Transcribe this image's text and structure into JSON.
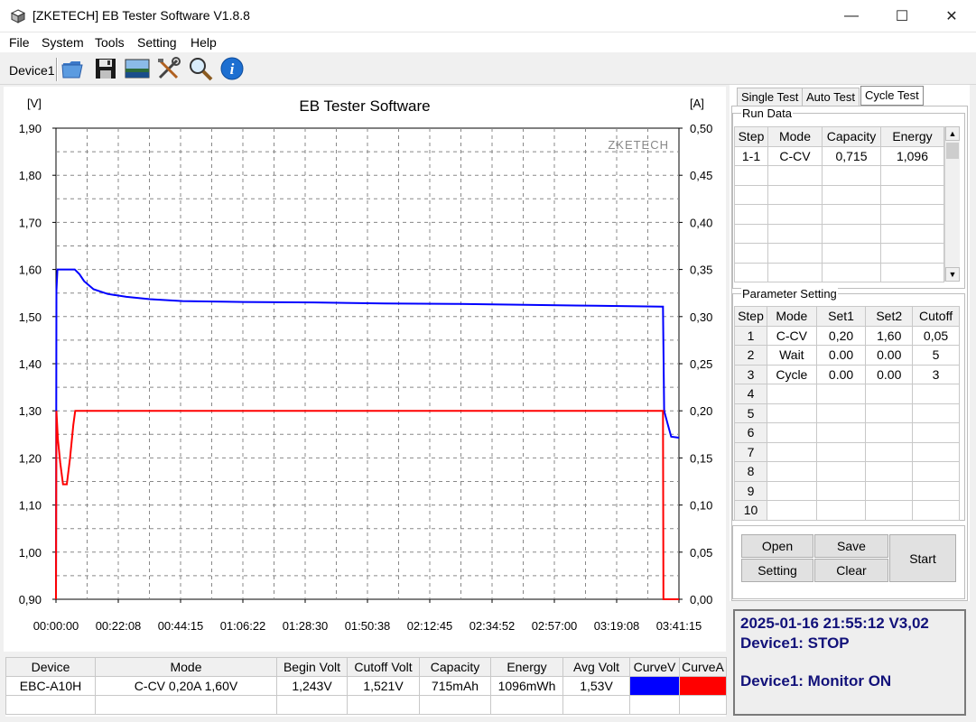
{
  "window": {
    "title": "[ZKETECH] EB Tester Software V1.8.8",
    "minimize": "—",
    "maximize": "☐",
    "close": "✕"
  },
  "menu": [
    "File",
    "System",
    "Tools",
    "Setting",
    "Help"
  ],
  "toolbar": {
    "device": "Device1",
    "icons": [
      "folder-icon",
      "save-icon",
      "image-icon",
      "tools-icon",
      "zoom-icon",
      "info-icon"
    ]
  },
  "chart_data": {
    "type": "line",
    "title": "EB Tester Software",
    "watermark": "ZKETECH",
    "left_axis_unit": "[V]",
    "right_axis_unit": "[A]",
    "ylim_left": [
      0.9,
      1.9
    ],
    "ylim_right": [
      0.0,
      0.5
    ],
    "left_ticks": [
      "1,90",
      "1,80",
      "1,70",
      "1,60",
      "1,50",
      "1,40",
      "1,30",
      "1,20",
      "1,10",
      "1,00",
      "0,90"
    ],
    "right_ticks": [
      "0,50",
      "0,45",
      "0,40",
      "0,35",
      "0,30",
      "0,25",
      "0,20",
      "0,15",
      "0,10",
      "0,05",
      "0,00"
    ],
    "x_ticks": [
      "00:00:00",
      "00:22:08",
      "00:44:15",
      "01:06:22",
      "01:28:30",
      "01:50:38",
      "02:12:45",
      "02:34:52",
      "02:57:00",
      "03:19:08",
      "03:41:15"
    ],
    "xlim_seconds": [
      0,
      13275
    ],
    "grid": true,
    "series": [
      {
        "name": "CurveV",
        "axis": "left",
        "color": "#0000ff",
        "points": [
          [
            0,
            0.9
          ],
          [
            10,
            1.555
          ],
          [
            30,
            1.6
          ],
          [
            400,
            1.6
          ],
          [
            500,
            1.59
          ],
          [
            600,
            1.575
          ],
          [
            800,
            1.558
          ],
          [
            1100,
            1.548
          ],
          [
            1500,
            1.542
          ],
          [
            2000,
            1.537
          ],
          [
            2700,
            1.533
          ],
          [
            4000,
            1.531
          ],
          [
            5500,
            1.53
          ],
          [
            7000,
            1.528
          ],
          [
            8500,
            1.527
          ],
          [
            10000,
            1.525
          ],
          [
            11500,
            1.523
          ],
          [
            12900,
            1.521
          ],
          [
            12935,
            1.521
          ],
          [
            12960,
            1.3
          ],
          [
            13040,
            1.27
          ],
          [
            13110,
            1.245
          ],
          [
            13275,
            1.243
          ]
        ]
      },
      {
        "name": "CurveA",
        "axis": "right",
        "color": "#ff0000",
        "points": [
          [
            0,
            0.0
          ],
          [
            10,
            0.2
          ],
          [
            40,
            0.17
          ],
          [
            90,
            0.145
          ],
          [
            150,
            0.122
          ],
          [
            230,
            0.122
          ],
          [
            300,
            0.15
          ],
          [
            370,
            0.185
          ],
          [
            410,
            0.2
          ],
          [
            12935,
            0.2
          ],
          [
            12945,
            0.0
          ],
          [
            13275,
            0.0
          ]
        ]
      }
    ]
  },
  "tabs": [
    "Single Test",
    "Auto Test",
    "Cycle Test"
  ],
  "active_tab": "Cycle Test",
  "run_data": {
    "label": "Run Data",
    "columns": [
      "Step",
      "Mode",
      "Capacity",
      "Energy"
    ],
    "rows": [
      [
        "1-1",
        "C-CV",
        "0,715",
        "1,096"
      ],
      [
        "",
        "",
        "",
        ""
      ],
      [
        "",
        "",
        "",
        ""
      ],
      [
        "",
        "",
        "",
        ""
      ],
      [
        "",
        "",
        "",
        ""
      ],
      [
        "",
        "",
        "",
        ""
      ],
      [
        "",
        "",
        "",
        ""
      ]
    ],
    "scroll_up": "▲",
    "scroll_down": "▼"
  },
  "parameter_setting": {
    "label": "Parameter Setting",
    "columns": [
      "Step",
      "Mode",
      "Set1",
      "Set2",
      "Cutoff"
    ],
    "rows": [
      [
        "1",
        "C-CV",
        "0,20",
        "1,60",
        "0,05"
      ],
      [
        "2",
        "Wait",
        "0.00",
        "0.00",
        "5"
      ],
      [
        "3",
        "Cycle",
        "0.00",
        "0.00",
        "3"
      ],
      [
        "4",
        "",
        "",
        "",
        ""
      ],
      [
        "5",
        "",
        "",
        "",
        ""
      ],
      [
        "6",
        "",
        "",
        "",
        ""
      ],
      [
        "7",
        "",
        "",
        "",
        ""
      ],
      [
        "8",
        "",
        "",
        "",
        ""
      ],
      [
        "9",
        "",
        "",
        "",
        ""
      ],
      [
        "10",
        "",
        "",
        "",
        ""
      ]
    ]
  },
  "buttons": {
    "open": "Open",
    "save": "Save",
    "setting": "Setting",
    "clear": "Clear",
    "start": "Start"
  },
  "status": {
    "line1": "2025-01-16 21:55:12  V3,02",
    "line2": "Device1: STOP",
    "line3": "Device1: Monitor ON"
  },
  "summary": {
    "columns": [
      "Device",
      "Mode",
      "Begin Volt",
      "Cutoff Volt",
      "Capacity",
      "Energy",
      "Avg Volt",
      "CurveV",
      "CurveA"
    ],
    "row": [
      "EBC-A10H",
      "C-CV  0,20A  1,60V",
      "1,243V",
      "1,521V",
      "715mAh",
      "1096mWh",
      "1,53V",
      "",
      ""
    ],
    "curve_colors": [
      "#0000ff",
      "#ff0000"
    ]
  }
}
